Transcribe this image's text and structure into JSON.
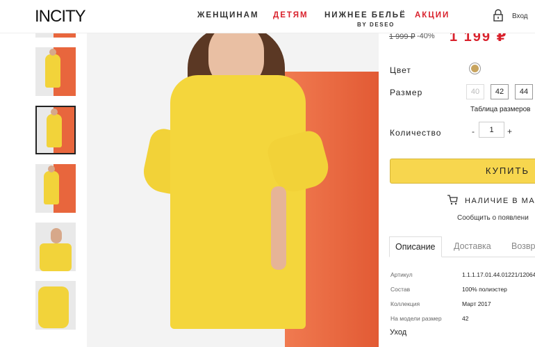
{
  "header": {
    "logo": "INCITY",
    "nav": [
      {
        "label": "ЖЕНЩИНАМ",
        "accent": false
      },
      {
        "label": "ДЕТЯМ",
        "accent": true
      },
      {
        "label": "НИЖНЕЕ БЕЛЬЁ",
        "accent": false
      },
      {
        "label": "АКЦИИ",
        "accent": true
      }
    ],
    "nav_sub": "BY DESEO",
    "login": "Вход",
    "accent_color": "#d9212c"
  },
  "product": {
    "old_price": "1 999 ₽",
    "discount": "-40%",
    "new_price": "1 199 ₽",
    "color_label": "Цвет",
    "color_value": "#c8a45e",
    "size_label": "Размер",
    "sizes": [
      {
        "label": "40",
        "available": false
      },
      {
        "label": "42",
        "available": true
      },
      {
        "label": "44",
        "available": true
      }
    ],
    "size_table": "Таблица размеров",
    "qty_label": "Количество",
    "qty_minus": "-",
    "qty_value": "1",
    "qty_plus": "+",
    "buy_label": "КУПИТЬ",
    "availability": "НАЛИЧИЕ В МА",
    "notify": "Сообщить о появлени"
  },
  "tabs": [
    "Описание",
    "Доставка",
    "Возвр"
  ],
  "specs": [
    {
      "key": "Артикул",
      "value": "1.1.1.17.01.44.01221/12064"
    },
    {
      "key": "Состав",
      "value": "100% полиэстер"
    },
    {
      "key": "Коллекция",
      "value": "Март 2017"
    },
    {
      "key": "На модели размер",
      "value": "42"
    }
  ],
  "care_heading": "Уход",
  "thumbnails": [
    "thumb-1",
    "thumb-2",
    "thumb-3",
    "thumb-4",
    "thumb-5",
    "thumb-6"
  ]
}
